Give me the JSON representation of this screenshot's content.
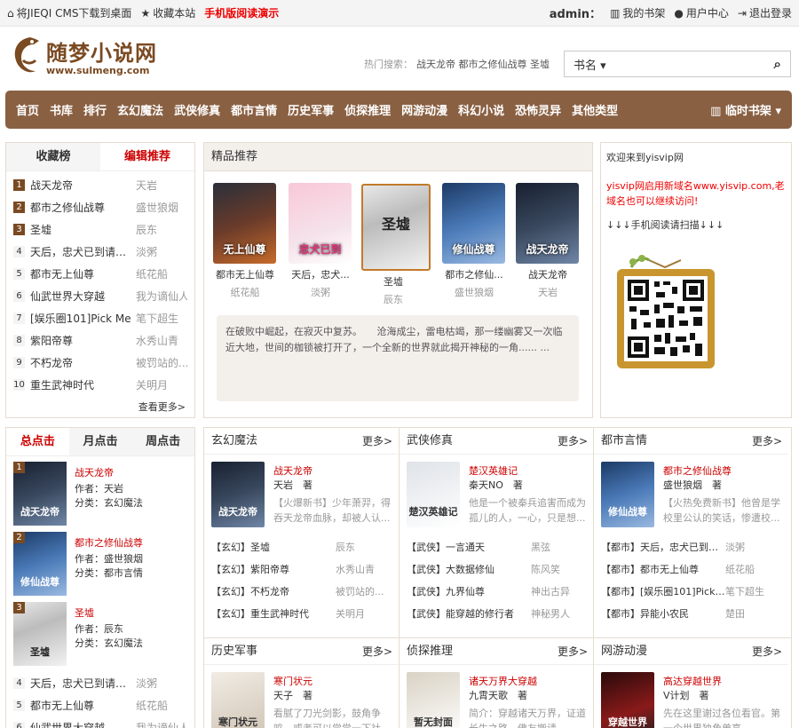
{
  "topbar": {
    "download": "将JIEQI CMS下载到桌面",
    "bookmark": "收藏本站",
    "mobile": "手机版阅读演示",
    "user": "admin：",
    "shelf": "我的书架",
    "center": "用户中心",
    "logout": "退出登录"
  },
  "logo": {
    "cn": "随梦小说网",
    "en": "www.sulmeng.com"
  },
  "hot": {
    "label": "热门搜索：",
    "terms": "战天龙帝 都市之修仙战尊 圣墟"
  },
  "search": {
    "type": "书名",
    "placeholder": ""
  },
  "nav": {
    "items": [
      "首页",
      "书库",
      "排行",
      "玄幻魔法",
      "武侠修真",
      "都市言情",
      "历史军事",
      "侦探推理",
      "网游动漫",
      "科幻小说",
      "恐怖灵异",
      "其他类型"
    ],
    "shelf": "临时书架"
  },
  "rank1": {
    "tabs": [
      "收藏榜",
      "编辑推荐"
    ],
    "more": "查看更多>",
    "items": [
      {
        "n": "1",
        "t": "战天龙帝",
        "a": "天岩"
      },
      {
        "n": "2",
        "t": "都市之修仙战尊",
        "a": "盛世狼烟"
      },
      {
        "n": "3",
        "t": "圣墟",
        "a": "辰东"
      },
      {
        "n": "4",
        "t": "天后，忠犬已到请签收",
        "a": "淡粥"
      },
      {
        "n": "5",
        "t": "都市无上仙尊",
        "a": "纸花船"
      },
      {
        "n": "6",
        "t": "仙武世界大穿越",
        "a": "我为谪仙人"
      },
      {
        "n": "7",
        "t": "[娱乐圈101]Pick Me",
        "a": "笔下超生"
      },
      {
        "n": "8",
        "t": "紫阳帝尊",
        "a": "水秀山青"
      },
      {
        "n": "9",
        "t": "不朽龙帝",
        "a": "被罚站的..."
      },
      {
        "n": "10",
        "t": "重生武神时代",
        "a": "关明月"
      }
    ]
  },
  "featured": {
    "title": "精品推荐",
    "books": [
      {
        "t": "都市无上仙尊",
        "a": "纸花船",
        "c": "无上仙尊"
      },
      {
        "t": "天后，忠犬...",
        "a": "淡粥",
        "c": "忠犬已到"
      },
      {
        "t": "圣墟",
        "a": "辰东",
        "c": "圣墟"
      },
      {
        "t": "都市之修仙...",
        "a": "盛世狼烟",
        "c": "修仙战尊"
      },
      {
        "t": "战天龙帝",
        "a": "天岩",
        "c": "战天龙帝"
      }
    ],
    "intro": "在破败中崛起，在寂灭中复苏。　　沧海成尘，雷电枯竭，那一缕幽雾又一次临近大地，世间的枷锁被打开了，一个全新的世界就此揭开神秘的一角...... ..."
  },
  "notice": {
    "welcome": "欢迎来到yisvip网",
    "msg": "yisvip网启用新域名www.yisvip.com,老域名也可以继续访问!",
    "scan": "↓↓↓手机阅读请扫描↓↓↓"
  },
  "rank2": {
    "tabs": [
      "总点击",
      "月点击",
      "周点击"
    ],
    "top": [
      {
        "n": "1",
        "t": "战天龙帝",
        "a": "作者：天岩",
        "c": "分类：玄幻魔法",
        "cv": "战天龙帝"
      },
      {
        "n": "2",
        "t": "都市之修仙战尊",
        "a": "作者：盛世狼烟",
        "c": "分类：都市言情",
        "cv": "修仙战尊"
      },
      {
        "n": "3",
        "t": "圣墟",
        "a": "作者：辰东",
        "c": "分类：玄幻魔法",
        "cv": "圣墟"
      }
    ],
    "rest": [
      {
        "n": "4",
        "t": "天后，忠犬已到请签收",
        "a": "淡粥"
      },
      {
        "n": "5",
        "t": "都市无上仙尊",
        "a": "纸花船"
      },
      {
        "n": "6",
        "t": "仙武世界大穿越",
        "a": "我为谪仙人"
      }
    ]
  },
  "cats": [
    {
      "name": "玄幻魔法",
      "more": "更多>",
      "ft": "战天龙帝",
      "fa": "天岩　著",
      "fd": "【火爆新书】少年萧羿，得吞天龙帝血脉，却被人认...",
      "cv": "战天龙帝",
      "list": [
        {
          "b": "【玄幻】圣墟",
          "w": "辰东"
        },
        {
          "b": "【玄幻】紫阳帝尊",
          "w": "水秀山青"
        },
        {
          "b": "【玄幻】不朽龙帝",
          "w": "被罚站的..."
        },
        {
          "b": "【玄幻】重生武神时代",
          "w": "关明月"
        }
      ]
    },
    {
      "name": "武侠修真",
      "more": "更多>",
      "ft": "楚汉英雄记",
      "fa": "秦天NO　著",
      "fd": "他是一个被秦兵追害而成为孤儿的人，一心，只是想...",
      "cv": "楚汉英雄记",
      "list": [
        {
          "b": "【武侠】一言通天",
          "w": "黑弦"
        },
        {
          "b": "【武侠】大数据修仙",
          "w": "陈风笑"
        },
        {
          "b": "【武侠】九界仙尊",
          "w": "神出古异"
        },
        {
          "b": "【武侠】能穿越的修行者",
          "w": "神秘男人"
        }
      ]
    },
    {
      "name": "都市言情",
      "more": "更多>",
      "ft": "都市之修仙战尊",
      "fa": "盛世狼烟　著",
      "fd": "【火热免费新书】他曾是学校里公认的笑话，惨遭校...",
      "cv": "修仙战尊",
      "list": [
        {
          "b": "【都市】天后，忠犬已到请...",
          "w": "淡粥"
        },
        {
          "b": "【都市】都市无上仙尊",
          "w": "纸花船"
        },
        {
          "b": "【都市】[娱乐圈101]Pick ...",
          "w": "笔下超生"
        },
        {
          "b": "【都市】异能小农民",
          "w": "楚田"
        }
      ]
    },
    {
      "name": "历史军事",
      "more": "更多>",
      "ft": "寒门状元",
      "fa": "天子　著",
      "fd": "看腻了刀光剑影，鼓角争鸣，或者可以尝尝一下社会...",
      "cv": "寒门状元"
    },
    {
      "name": "侦探推理",
      "more": "更多>",
      "ft": "诸天万界大穿越",
      "fa": "九霄天歌　著",
      "fd": "简介：穿越诸天万界，证道长生之路，佛友搬请...",
      "cv": "暂无封面"
    },
    {
      "name": "网游动漫",
      "more": "更多>",
      "ft": "高达穿越世界",
      "fa": "V计划　著",
      "fd": "先在这里谢过各位看官。第一个世界独角兽高...",
      "cv": "穿越世界"
    }
  ],
  "colors": {
    "nav": "#8a6042",
    "accent": "#c00",
    "brand": "#7a4a22"
  }
}
